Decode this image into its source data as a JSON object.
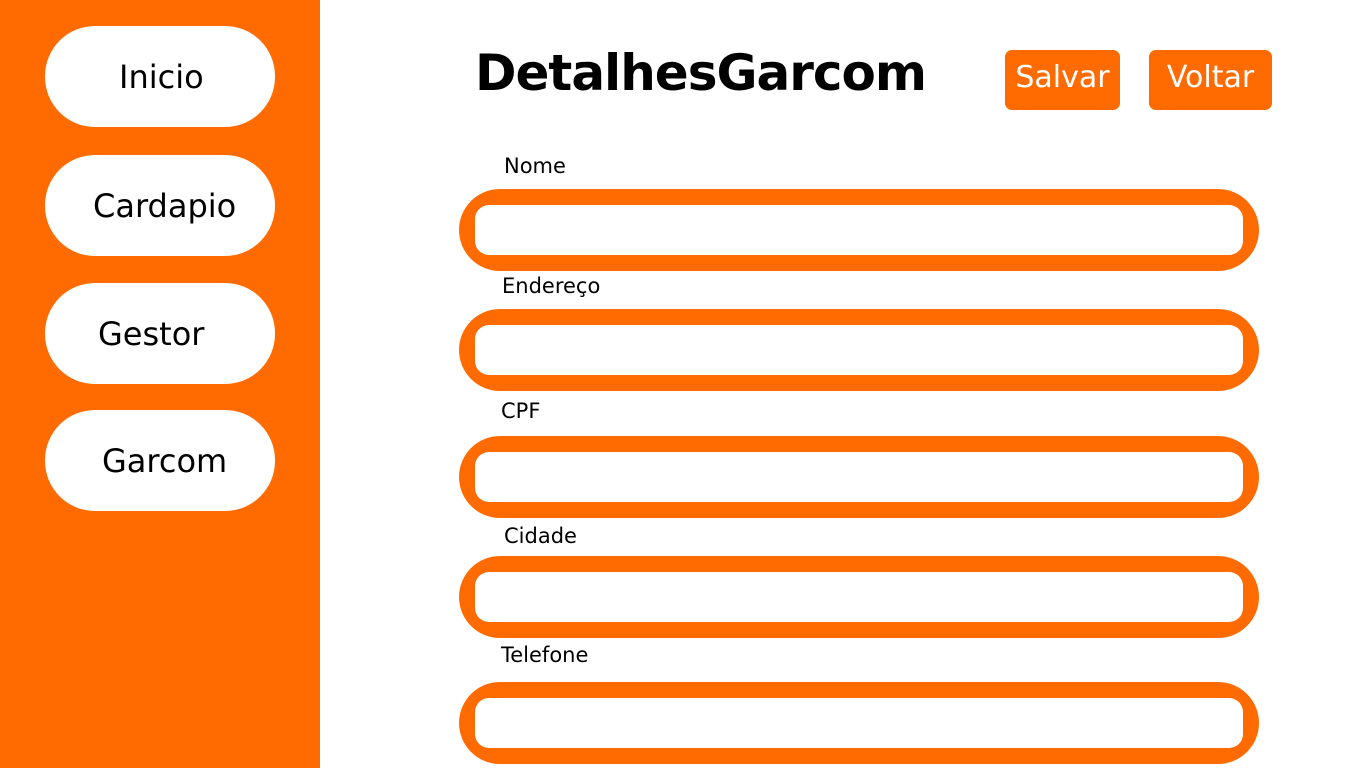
{
  "sidebar": {
    "items": [
      {
        "label": "Inicio"
      },
      {
        "label": "Cardapio"
      },
      {
        "label": "Gestor"
      },
      {
        "label": "Garcom"
      }
    ]
  },
  "header": {
    "title": "DetalhesGarcom",
    "save_label": "Salvar",
    "back_label": "Voltar"
  },
  "form": {
    "fields": [
      {
        "label": "Nome",
        "value": ""
      },
      {
        "label": "Endereço",
        "value": ""
      },
      {
        "label": "CPF",
        "value": ""
      },
      {
        "label": "Cidade",
        "value": ""
      },
      {
        "label": "Telefone",
        "value": ""
      }
    ]
  },
  "colors": {
    "accent": "#ff6b00",
    "background": "#ffffff",
    "text": "#000000"
  }
}
